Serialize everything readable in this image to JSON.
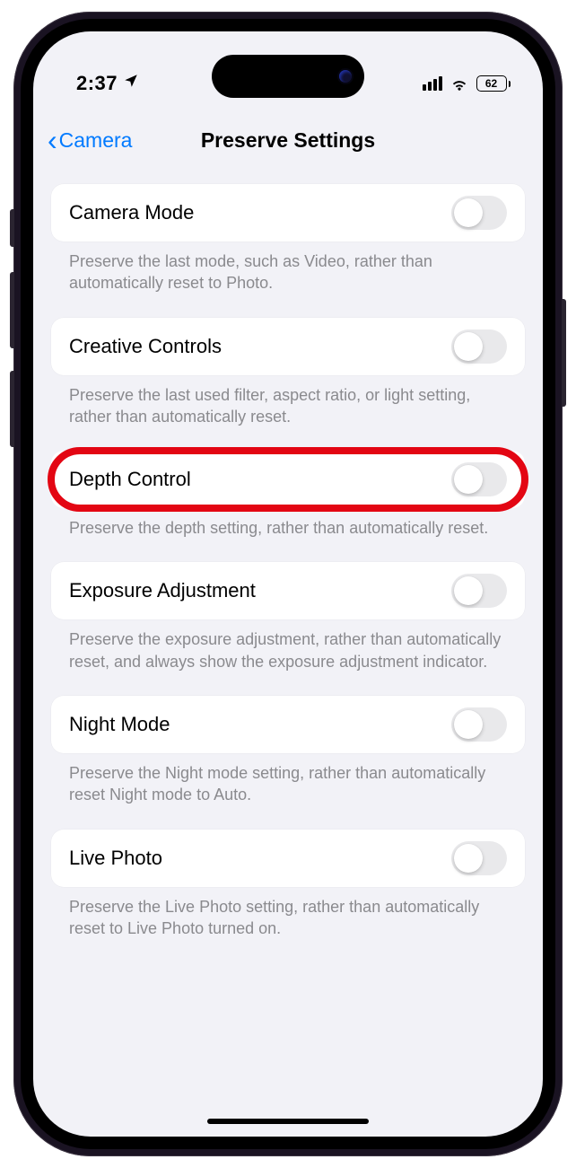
{
  "status": {
    "time": "2:37",
    "battery_pct": "62"
  },
  "nav": {
    "back_label": "Camera",
    "title": "Preserve Settings"
  },
  "settings": [
    {
      "label": "Camera Mode",
      "desc": "Preserve the last mode, such as Video, rather than automatically reset to Photo.",
      "on": false,
      "highlight": false
    },
    {
      "label": "Creative Controls",
      "desc": "Preserve the last used filter, aspect ratio, or light setting, rather than automatically reset.",
      "on": false,
      "highlight": false
    },
    {
      "label": "Depth Control",
      "desc": "Preserve the depth setting, rather than automatically reset.",
      "on": false,
      "highlight": true
    },
    {
      "label": "Exposure Adjustment",
      "desc": "Preserve the exposure adjustment, rather than automatically reset, and always show the exposure adjustment indicator.",
      "on": false,
      "highlight": false
    },
    {
      "label": "Night Mode",
      "desc": "Preserve the Night mode setting, rather than automatically reset Night mode to Auto.",
      "on": false,
      "highlight": false
    },
    {
      "label": "Live Photo",
      "desc": "Preserve the Live Photo setting, rather than automatically reset to Live Photo turned on.",
      "on": false,
      "highlight": false
    }
  ]
}
